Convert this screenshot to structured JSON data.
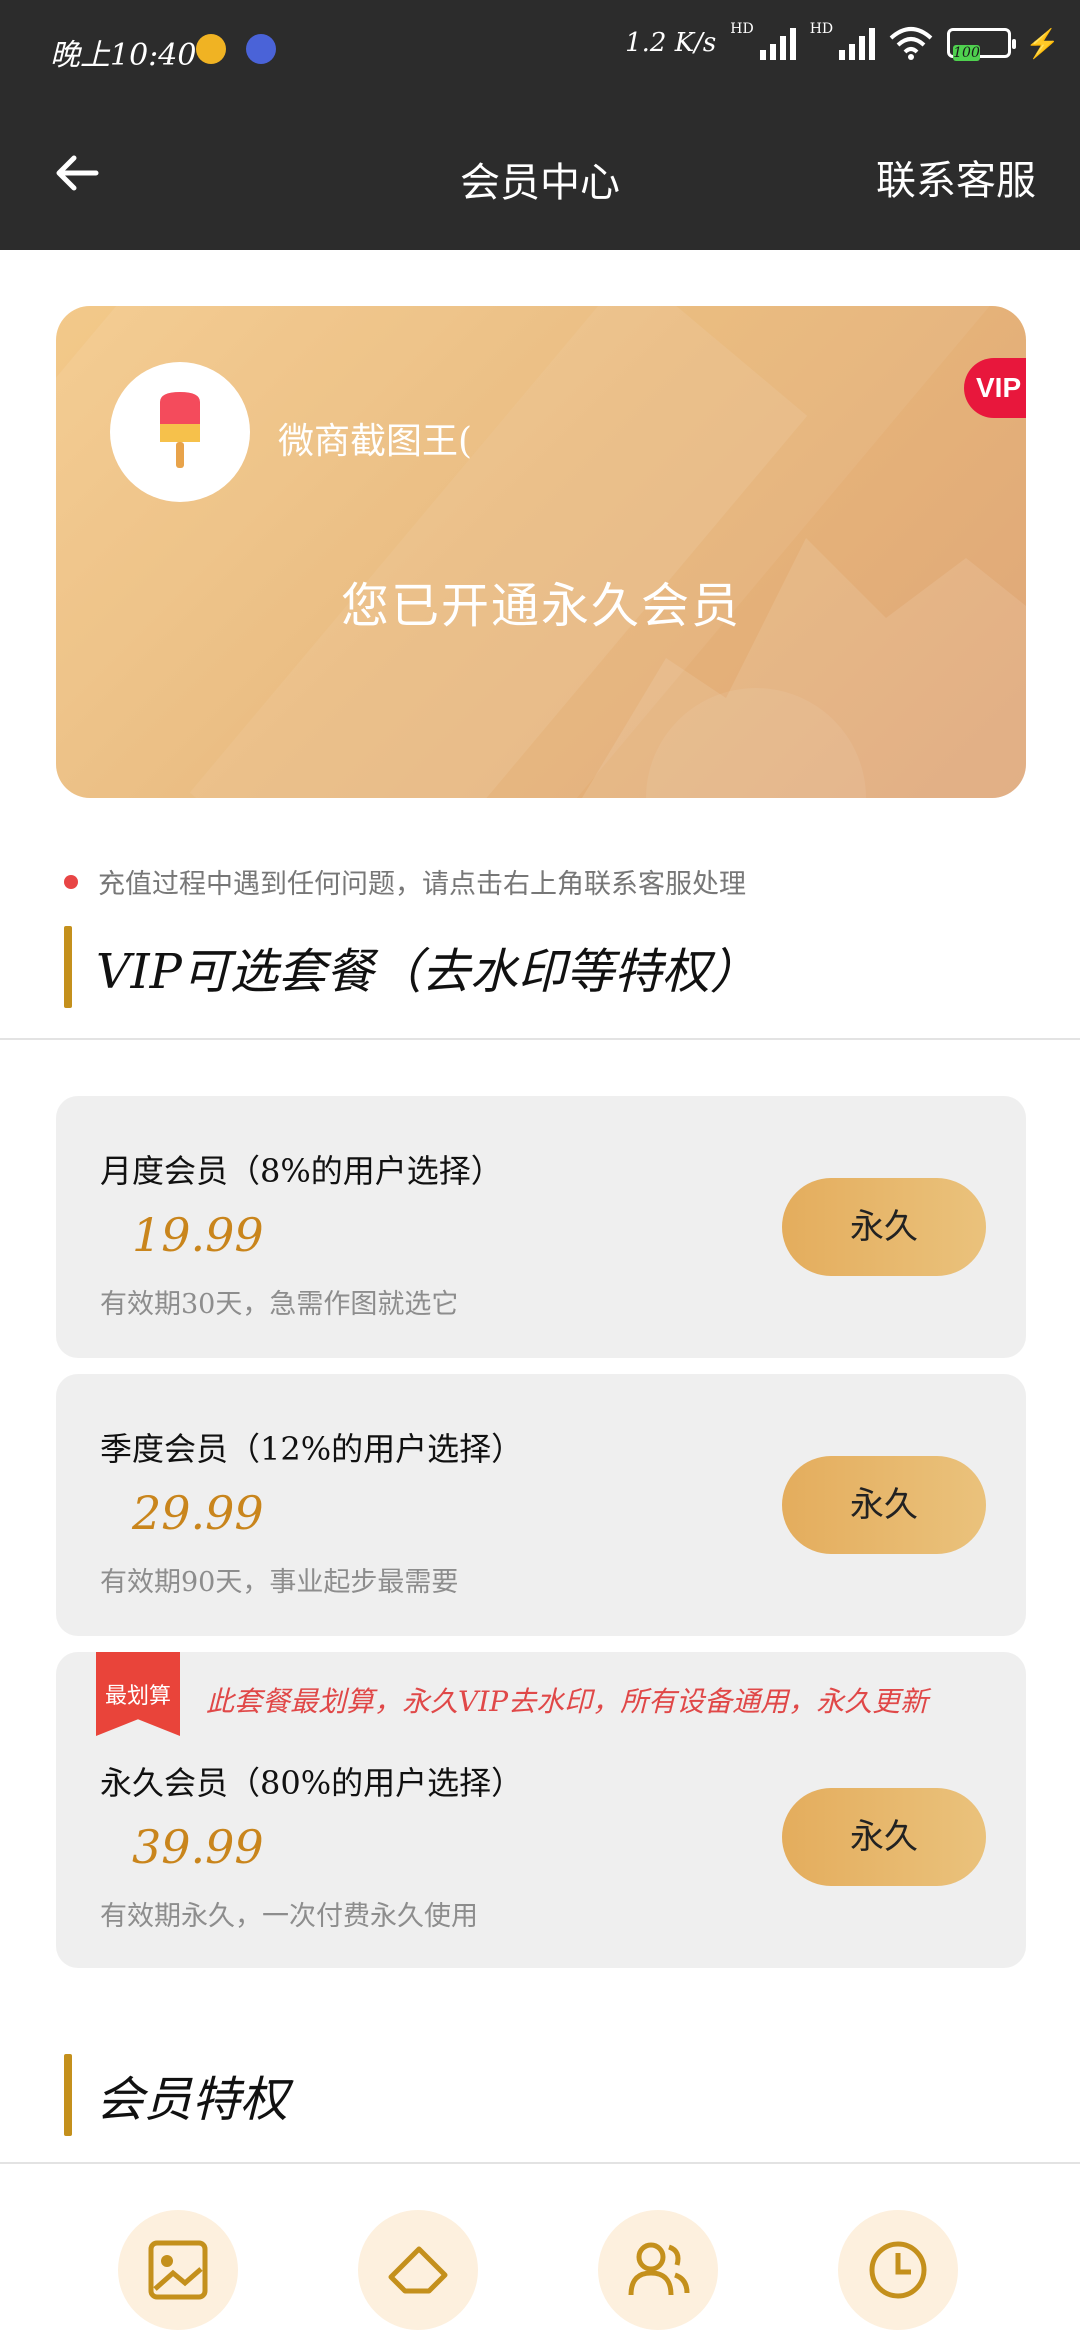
{
  "status_bar": {
    "time": "晚上10:40",
    "net_speed": "1.2 K/s",
    "hd1": "HD",
    "hd2": "HD",
    "battery": "100"
  },
  "header": {
    "title": "会员中心",
    "contact": "联系客服"
  },
  "vip_card": {
    "username": "微商截图王(",
    "badge": "VIP",
    "status": "您已开通永久会员"
  },
  "notice": "充值过程中遇到任何问题，请点击右上角联系客服处理",
  "plans_section": {
    "title": "VIP可选套餐（去水印等特权）"
  },
  "plans": [
    {
      "name": "月度会员（8%的用户选择）",
      "price": "19.99",
      "desc": "有效期30天，急需作图就选它",
      "button": "永久"
    },
    {
      "name": "季度会员（12%的用户选择）",
      "price": "29.99",
      "desc": "有效期90天，事业起步最需要",
      "button": "永久"
    },
    {
      "name": "永久会员（80%的用户选择）",
      "price": "39.99",
      "desc": "有效期永久，一次付费永久使用",
      "button": "永久",
      "tag": "最划算",
      "note": "此套餐最划算，永久VIP去水印，所有设备通用，永久更新"
    }
  ],
  "privileges_section": {
    "title": "会员特权"
  },
  "privilege_icons": [
    "image-icon",
    "eraser-icon",
    "users-icon",
    "clock-icon"
  ],
  "colors": {
    "header_bg": "#2c2c2c",
    "accent_gold": "#c9851c",
    "button_gold": "#e4ad5d",
    "badge_red": "#e8173c",
    "note_red": "#e04848"
  }
}
